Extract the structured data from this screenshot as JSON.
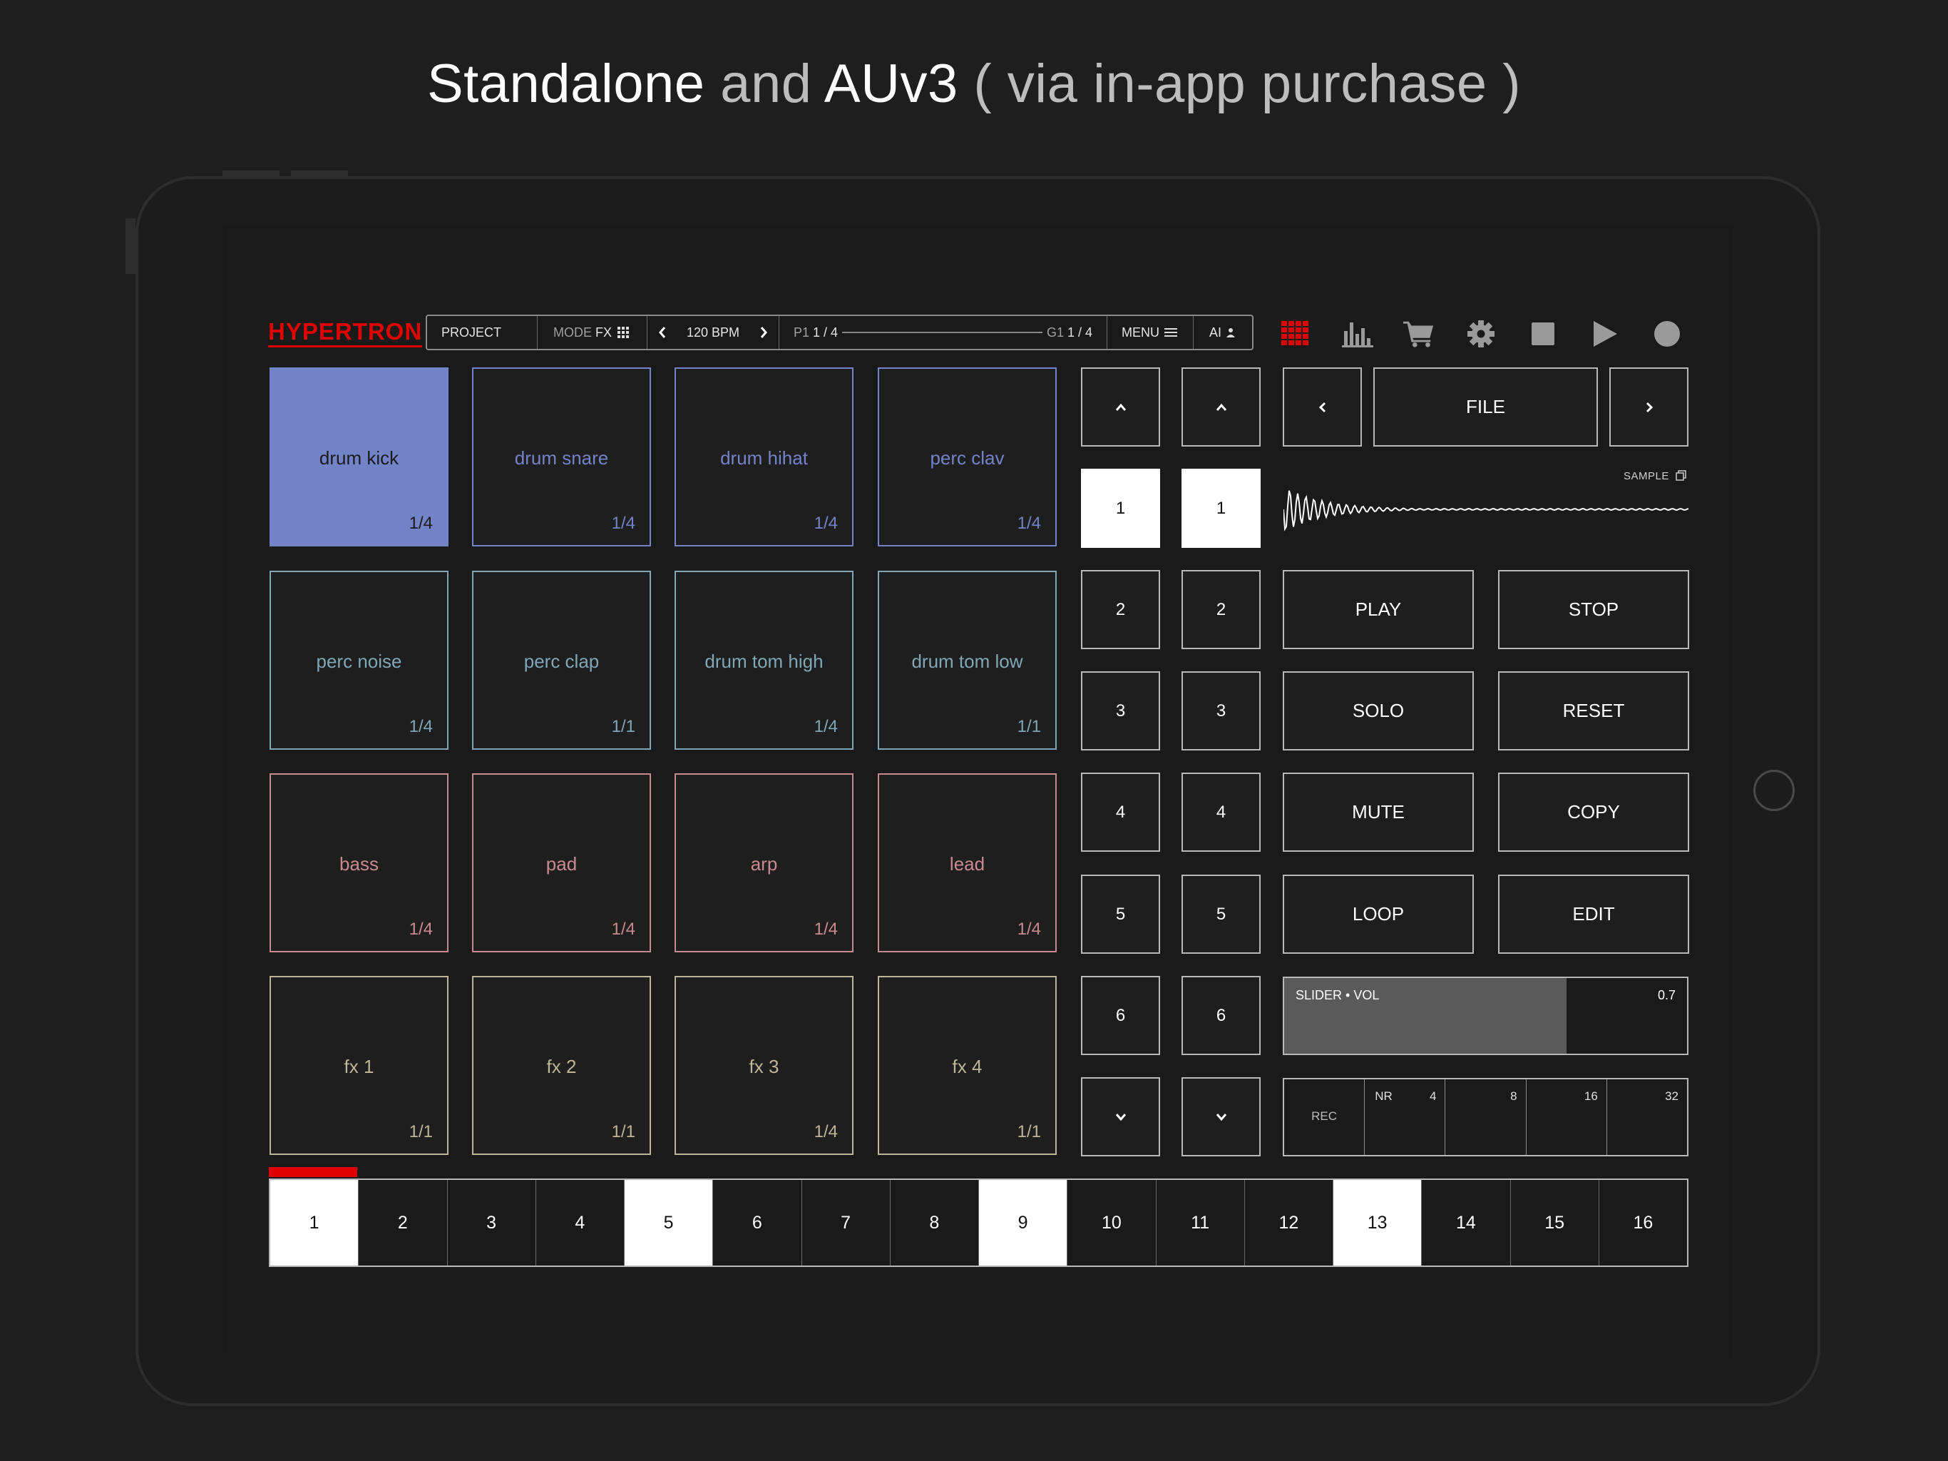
{
  "headline": {
    "w1": "Standalone",
    "g1": " and ",
    "w2": "AUv3",
    "g2": " ( via in-app purchase )"
  },
  "app": {
    "logo": "HYPERTRON",
    "topbar": {
      "project": "PROJECT",
      "mode_label": "MODE",
      "mode_value": "FX",
      "bpm": "120 BPM",
      "pattern": "P1",
      "pattern_page": "1 / 4",
      "group": "G1",
      "group_page": "1 / 4",
      "menu": "MENU",
      "ai": "AI"
    },
    "top_icons": [
      "grid-icon",
      "bars-chart-icon",
      "cart-icon",
      "gear-icon",
      "stop-icon",
      "play-icon",
      "record-icon"
    ],
    "accent_red": "#e10000",
    "pads": [
      {
        "name": "drum kick",
        "fraction": "1/4",
        "color": "#7383c8",
        "active": true
      },
      {
        "name": "drum snare",
        "fraction": "1/4",
        "color": "#7383c8",
        "active": false
      },
      {
        "name": "drum hihat",
        "fraction": "1/4",
        "color": "#7383c8",
        "active": false
      },
      {
        "name": "perc clav",
        "fraction": "1/4",
        "color": "#7383c8",
        "active": false
      },
      {
        "name": "perc noise",
        "fraction": "1/4",
        "color": "#7fa7b8",
        "active": false
      },
      {
        "name": "perc clap",
        "fraction": "1/1",
        "color": "#7fa7b8",
        "active": false
      },
      {
        "name": "drum tom high",
        "fraction": "1/4",
        "color": "#7fa7b8",
        "active": false
      },
      {
        "name": "drum tom low",
        "fraction": "1/1",
        "color": "#7fa7b8",
        "active": false
      },
      {
        "name": "bass",
        "fraction": "1/4",
        "color": "#c98990",
        "active": false
      },
      {
        "name": "pad",
        "fraction": "1/4",
        "color": "#c98990",
        "active": false
      },
      {
        "name": "arp",
        "fraction": "1/4",
        "color": "#c98990",
        "active": false
      },
      {
        "name": "lead",
        "fraction": "1/4",
        "color": "#c98990",
        "active": false
      },
      {
        "name": "fx 1",
        "fraction": "1/1",
        "color": "#bcb596",
        "active": false
      },
      {
        "name": "fx 2",
        "fraction": "1/1",
        "color": "#bcb596",
        "active": false
      },
      {
        "name": "fx 3",
        "fraction": "1/4",
        "color": "#bcb596",
        "active": false
      },
      {
        "name": "fx 4",
        "fraction": "1/1",
        "color": "#bcb596",
        "active": false
      }
    ],
    "columns": [
      {
        "numbers": [
          "1",
          "2",
          "3",
          "4",
          "5",
          "6"
        ],
        "selected": "1"
      },
      {
        "numbers": [
          "1",
          "2",
          "3",
          "4",
          "5",
          "6"
        ],
        "selected": "1"
      }
    ],
    "file": {
      "label": "FILE",
      "sample_label": "SAMPLE"
    },
    "actions": [
      "PLAY",
      "STOP",
      "SOLO",
      "RESET",
      "MUTE",
      "COPY",
      "LOOP",
      "EDIT"
    ],
    "slider": {
      "label": "SLIDER • VOL",
      "value": "0.7",
      "level": 0.7
    },
    "rec": {
      "label": "REC",
      "nr_label": "NR",
      "values": [
        "4",
        "8",
        "16",
        "32"
      ]
    },
    "steps": {
      "labels": [
        "1",
        "2",
        "3",
        "4",
        "5",
        "6",
        "7",
        "8",
        "9",
        "10",
        "11",
        "12",
        "13",
        "14",
        "15",
        "16"
      ],
      "active": [
        "1",
        "5",
        "9",
        "13"
      ],
      "playhead_step": 1
    }
  }
}
